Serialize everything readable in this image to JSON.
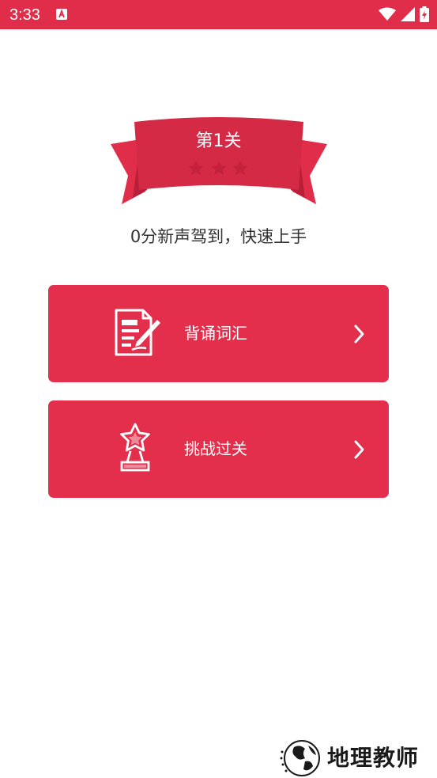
{
  "status_bar": {
    "time": "3:33",
    "icons": [
      "notification-a-icon",
      "wifi-icon",
      "signal-icon",
      "battery-charging-icon"
    ]
  },
  "level": {
    "title": "第1关",
    "stars_earned": 0,
    "stars_total": 3,
    "subtitle": "0分新声驾到，快速上手"
  },
  "actions": [
    {
      "label": "背诵词汇",
      "icon": "document-pen-icon"
    },
    {
      "label": "挑战过关",
      "icon": "star-trophy-icon"
    }
  ],
  "watermark": {
    "text": "地理教师"
  },
  "colors": {
    "brand_red": "#e32f4b",
    "ribbon_dark": "#d42a45",
    "star_inactive": "#c4223c"
  }
}
